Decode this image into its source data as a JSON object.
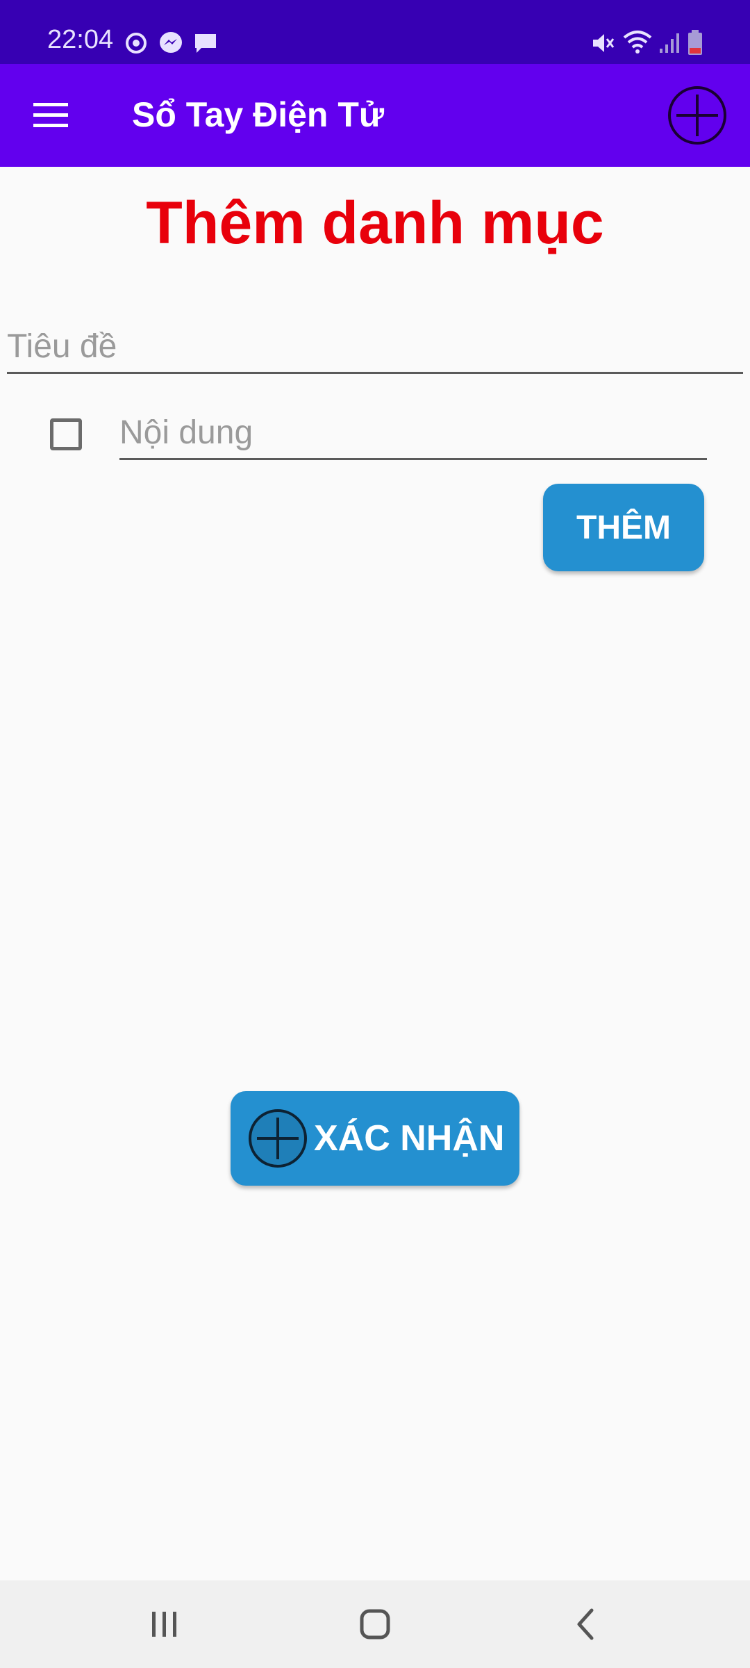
{
  "status_bar": {
    "time": "22:04",
    "left_icons": [
      "sync-icon",
      "messenger-icon",
      "chat-bubble-icon"
    ],
    "right_icons": [
      "mute-icon",
      "wifi-icon",
      "signal-icon",
      "battery-icon"
    ]
  },
  "app_bar": {
    "title": "Sổ Tay Điện Tử",
    "menu_icon": "hamburger-menu-icon",
    "action_icon": "add-circle-icon"
  },
  "page": {
    "heading": "Thêm danh mục"
  },
  "form": {
    "title_placeholder": "Tiêu đề",
    "title_value": "",
    "content_placeholder": "Nội dung",
    "content_value": "",
    "checkbox_checked": false,
    "add_button_label": "THÊM",
    "confirm_button_label": "XÁC NHẬN"
  },
  "nav_bar": {
    "buttons": [
      "recent-apps-icon",
      "home-icon",
      "back-icon"
    ]
  },
  "colors": {
    "status_bar": "#3700b3",
    "app_bar": "#6200ee",
    "heading": "#e8000b",
    "button": "#2490d0",
    "background": "#fafafa"
  }
}
